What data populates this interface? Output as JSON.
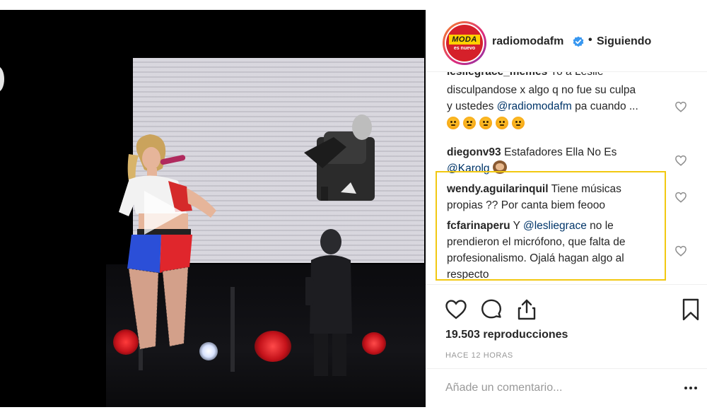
{
  "post": {
    "username": "radiomodafm",
    "verified": true,
    "separator": "•",
    "follow_status": "Siguiendo",
    "avatar_logo_text": "MODA",
    "avatar_logo_sub": "es nuevo"
  },
  "comments": [
    {
      "user": "lesliegrace_memes",
      "text_parts": [
        "Yo a Leslie"
      ],
      "partial": true
    },
    {
      "text_line1": "disculpandose x algo q no fue su culpa",
      "text_line2_prefix": "y ustedes ",
      "mention": "@radiomodafm",
      "text_line2_suffix": " pa cuando ...",
      "emoji_count": 5,
      "emoji": "angry-face"
    },
    {
      "user": "diegonv93",
      "text": "Estafadores Ella No Es",
      "mention": "@Karolg",
      "emoji": "see-no-evil-monkey"
    },
    {
      "user": "wendy.aguilarinquil",
      "text_line1": "Tiene músicas",
      "text_line2": "propias ?? Por canta biem feooo"
    },
    {
      "user": "fcfarinaperu",
      "text_prefix": "Y",
      "mention": "@lesliegrace",
      "text_line1_suffix": "no le",
      "text_line2": "prendieron el micrófono, que falta de",
      "text_line3": "profesionalismo. Ojalá hagan algo al",
      "text_line4": "respecto"
    }
  ],
  "stats": {
    "views": "19.503 reproducciones",
    "time_ago": "HACE 12 HORAS"
  },
  "comment_box": {
    "placeholder": "Añade un comentario..."
  },
  "icons": {
    "like": "heart-icon",
    "comment": "comment-bubble-icon",
    "share": "share-icon",
    "save": "bookmark-icon",
    "more": "more-dots-icon",
    "play": "play-icon"
  },
  "colors": {
    "highlight": "#f2c811",
    "mention": "#003569",
    "verified": "#3897f0",
    "meta_text": "#999999"
  }
}
